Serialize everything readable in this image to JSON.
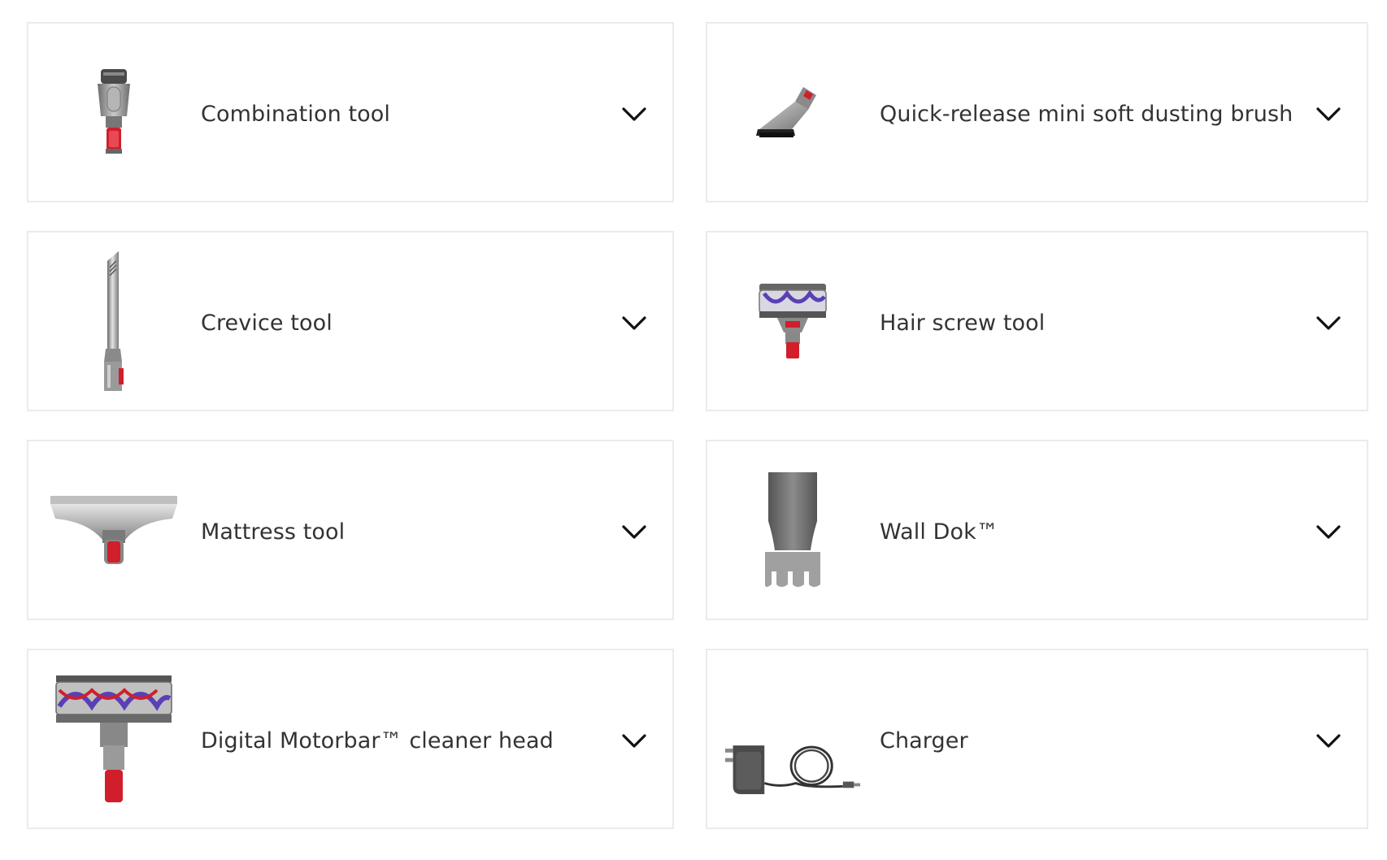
{
  "accessories": [
    {
      "label": "Combination tool",
      "icon": "combination-tool-icon"
    },
    {
      "label": "Quick-release mini soft dusting brush",
      "icon": "dusting-brush-icon"
    },
    {
      "label": "Crevice tool",
      "icon": "crevice-tool-icon"
    },
    {
      "label": "Hair screw tool",
      "icon": "hair-screw-tool-icon"
    },
    {
      "label": "Mattress tool",
      "icon": "mattress-tool-icon"
    },
    {
      "label": "Wall Dok™",
      "icon": "wall-dok-icon"
    },
    {
      "label": "Digital Motorbar™ cleaner head",
      "icon": "motorbar-cleaner-head-icon"
    },
    {
      "label": "Charger",
      "icon": "charger-icon"
    }
  ],
  "expand_icon": "chevron-down-icon",
  "colors": {
    "text": "#333333",
    "border": "#ebebeb",
    "tool_grey": "#9a9a9a",
    "tool_dark": "#555555",
    "dyson_red": "#d01f2b",
    "brush_purple": "#5a3fb5"
  }
}
